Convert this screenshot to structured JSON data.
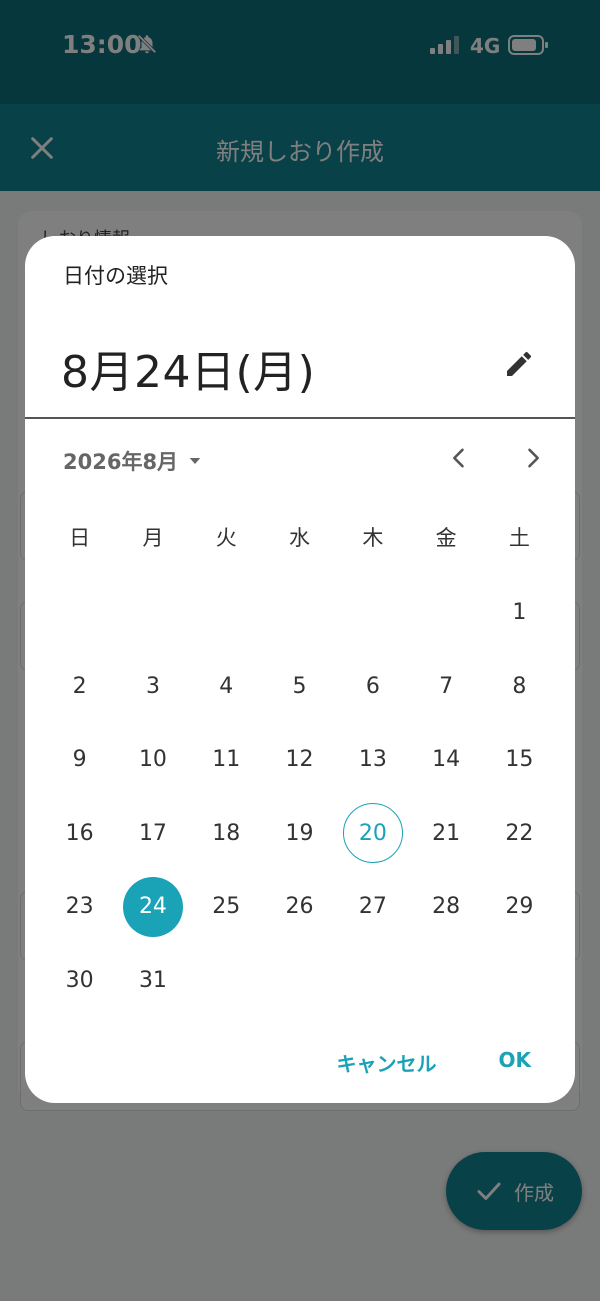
{
  "status_bar": {
    "time": "13:00",
    "network": "4G"
  },
  "app_bar": {
    "title": "新規しおり作成"
  },
  "page": {
    "section_label": "しおり情報"
  },
  "fab": {
    "label": "作成"
  },
  "dialog": {
    "title": "日付の選択",
    "selected_date": "8月24日(月)",
    "month_label": "2026年8月",
    "weekdays": [
      "日",
      "月",
      "火",
      "水",
      "木",
      "金",
      "土"
    ],
    "leading_blank_days": 6,
    "days": [
      "1",
      "2",
      "3",
      "4",
      "5",
      "6",
      "7",
      "8",
      "9",
      "10",
      "11",
      "12",
      "13",
      "14",
      "15",
      "16",
      "17",
      "18",
      "19",
      "20",
      "21",
      "22",
      "23",
      "24",
      "25",
      "26",
      "27",
      "28",
      "29",
      "30",
      "31"
    ],
    "today_day": "20",
    "selected_day": "24",
    "cancel_label": "キャンセル",
    "ok_label": "OK"
  },
  "colors": {
    "accent": "#1aa2b7",
    "app_bar": "#128391",
    "status_bar": "#0d6e78"
  },
  "icons": [
    "bell-off-icon",
    "signal-icon",
    "battery-icon",
    "close-icon",
    "pencil-icon",
    "caret-down-icon",
    "chevron-left-icon",
    "chevron-right-icon",
    "check-icon"
  ]
}
